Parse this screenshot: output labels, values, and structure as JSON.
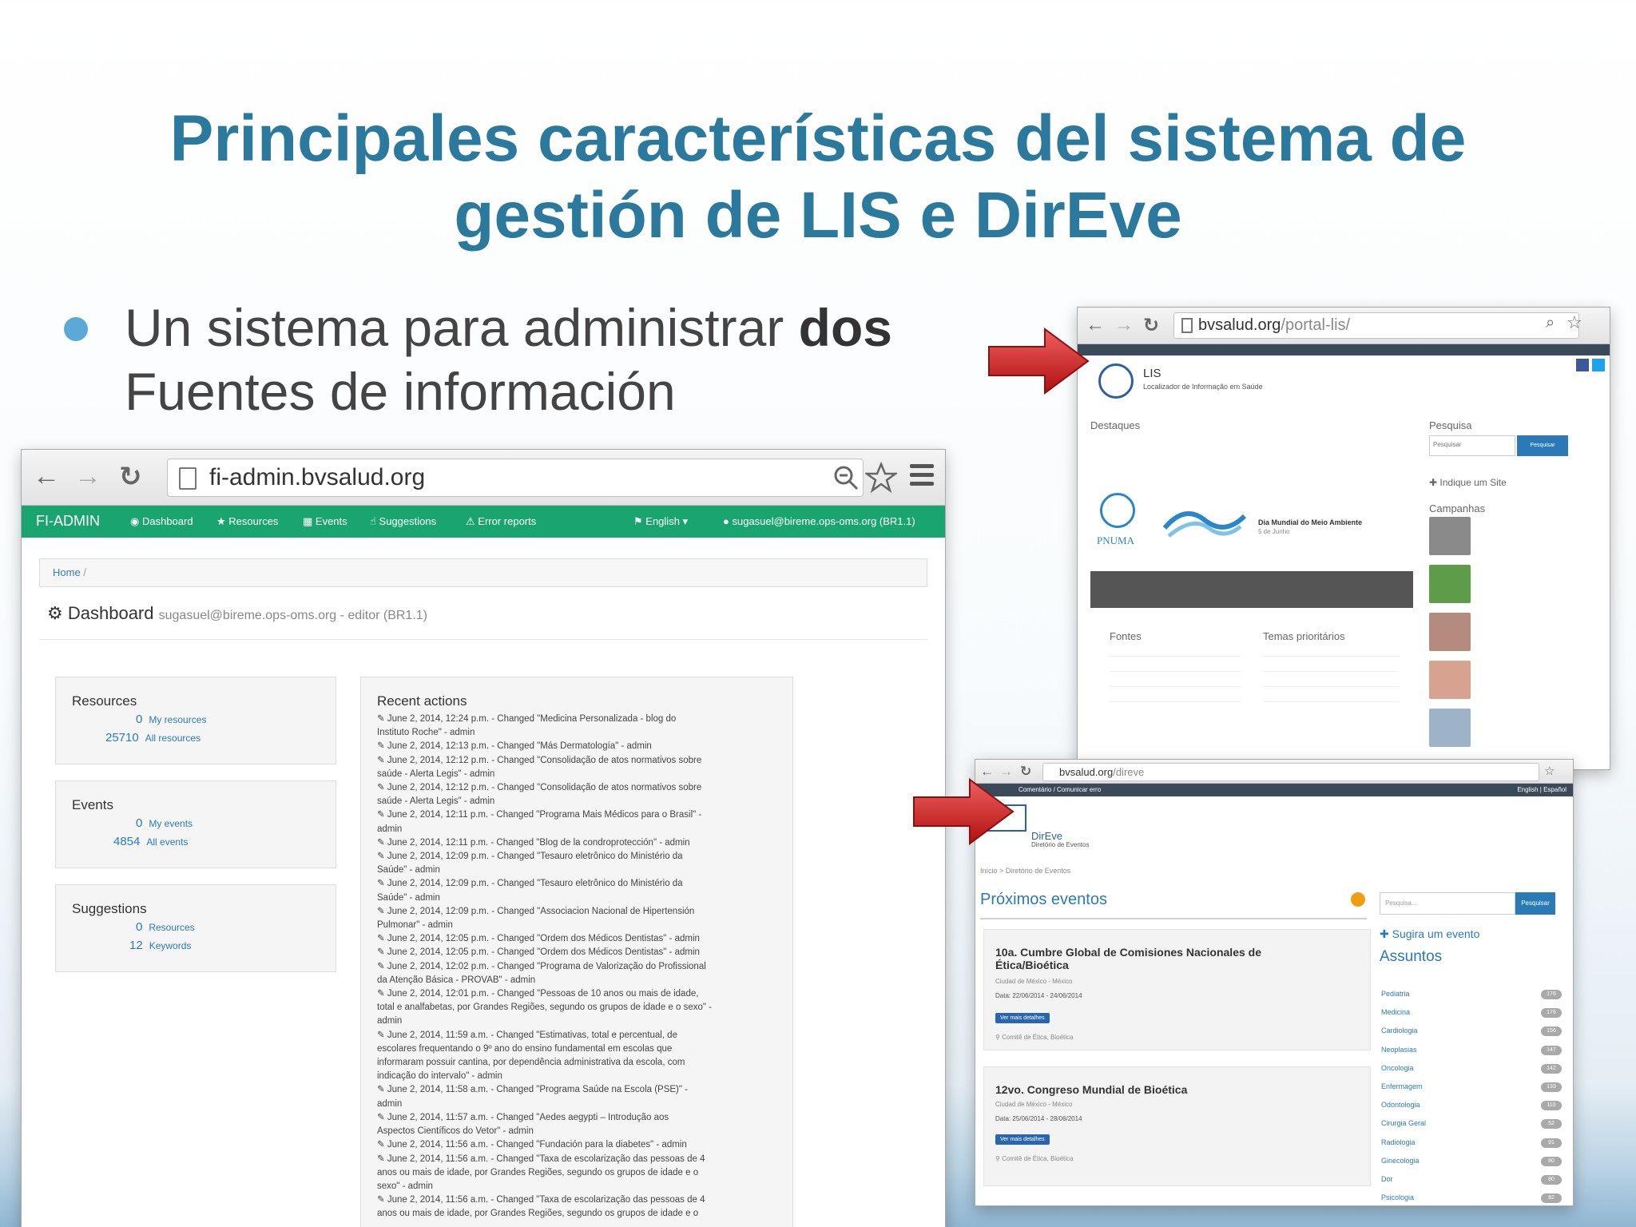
{
  "slide": {
    "title_line1": "Principales características del sistema de",
    "title_line2": "gestión de LIS e DirEve",
    "bullet_line1_pre": "Un sistema para administrar ",
    "bullet_line1_bold": "dos",
    "bullet_line2": "Fuentes de información"
  },
  "fi_admin": {
    "url": "fi-admin.bvsalud.org",
    "brand": "FI-ADMIN",
    "nav": [
      "Dashboard",
      "Resources",
      "Events",
      "Suggestions",
      "Error reports"
    ],
    "language": "English",
    "user": "sugasuel@bireme.ops-oms.org (BR1.1)",
    "breadcrumb": "Home",
    "dashboard_title": "Dashboard",
    "dashboard_sub": "sugasuel@bireme.ops-oms.org - editor (BR1.1)",
    "resources": {
      "title": "Resources",
      "my_count": "0",
      "my_label": "My resources",
      "all_count": "25710",
      "all_label": "All resources"
    },
    "events": {
      "title": "Events",
      "my_count": "0",
      "my_label": "My events",
      "all_count": "4854",
      "all_label": "All events"
    },
    "suggestions": {
      "title": "Suggestions",
      "res_count": "0",
      "res_label": "Resources",
      "kw_count": "12",
      "kw_label": "Keywords"
    },
    "recent_title": "Recent actions",
    "recent_lines": [
      "✎ June 2, 2014, 12:24 p.m. - Changed \"Medicina Personalizada - blog do",
      "Instituto Roche\" - admin",
      "✎ June 2, 2014, 12:13 p.m. - Changed \"Más Dermatología\" - admin",
      "✎ June 2, 2014, 12:12 p.m. - Changed \"Consolidação de atos normativos sobre",
      "saúde - Alerta Legis\" - admin",
      "✎ June 2, 2014, 12:12 p.m. - Changed \"Consolidação de atos normativos sobre",
      "saúde - Alerta Legis\" - admin",
      "✎ June 2, 2014, 12:11 p.m. - Changed \"Programa Mais Médicos para o Brasil\" -",
      "admin",
      "✎ June 2, 2014, 12:11 p.m. - Changed \"Blog de la condroprotección\" - admin",
      "✎ June 2, 2014, 12:09 p.m. - Changed \"Tesauro eletrônico do Ministério da",
      "Saúde\" - admin",
      "✎ June 2, 2014, 12:09 p.m. - Changed \"Tesauro eletrônico do Ministério da",
      "Saúde\" - admin",
      "✎ June 2, 2014, 12:09 p.m. - Changed \"Associacion Nacional de Hipertensión",
      "Pulmonar\" - admin",
      "✎ June 2, 2014, 12:05 p.m. - Changed \"Ordem dos Médicos Dentistas\" - admin",
      "✎ June 2, 2014, 12:05 p.m. - Changed \"Ordem dos Médicos Dentistas\" - admin",
      "✎ June 2, 2014, 12:02 p.m. - Changed \"Programa de Valorização do Profissional",
      "da Atenção Básica - PROVAB\" - admin",
      "✎ June 2, 2014, 12:01 p.m. - Changed \"Pessoas de 10 anos ou mais de idade,",
      "total e analfabetas, por Grandes Regiões, segundo os grupos de idade e o sexo\" -",
      "admin",
      "✎ June 2, 2014, 11:59 a.m. - Changed \"Estimativas, total e percentual, de",
      "escolares frequentando o 9º ano do ensino fundamental em escolas que",
      "informaram possuir cantina, por dependência administrativa da escola, com",
      "indicação do intervalo\" - admin",
      "✎ June 2, 2014, 11:58 a.m. - Changed \"Programa Saúde na Escola (PSE)\" -",
      "admin",
      "✎ June 2, 2014, 11:57 a.m. - Changed \"Aedes aegypti – Introdução aos",
      "Aspectos Científicos do Vetor\" - admin",
      "✎ June 2, 2014, 11:56 a.m. - Changed \"Fundación para la diabetes\" - admin",
      "✎ June 2, 2014, 11:56 a.m. - Changed \"Taxa de escolarização das pessoas de 4",
      "anos ou mais de idade, por Grandes Regiões, segundo os grupos de idade e o",
      "sexo\" - admin",
      "✎ June 2, 2014, 11:56 a.m. - Changed \"Taxa de escolarização das pessoas de 4",
      "anos ou mais de idade, por Grandes Regiões, segundo os grupos de idade e o"
    ]
  },
  "lis": {
    "url_domain": "bvsalud.org",
    "url_path": "/portal-lis/",
    "site_title": "LIS",
    "site_subtitle": "Localizador de Informação em Saúde",
    "destaques": "Destaques",
    "pesquisa": "Pesquisa",
    "search_placeholder": "Pesquisar",
    "search_button": "Pesquisar",
    "indique": "Indique um Site",
    "campanhas": "Campanhas",
    "pnuma": "PNUMA",
    "banner_title": "Dia Mundial do Meio Ambiente",
    "banner_date": "5 de Junho",
    "fontes": "Fontes",
    "temas": "Temas prioritários"
  },
  "direve": {
    "url_domain": "bvsalud.org",
    "url_path": "/direve",
    "top_bar": "Comentário / Comunicar erro",
    "top_right": "English | Español",
    "site_title": "DirEve",
    "site_subtitle": "Diretório de Eventos",
    "breadcrumb": "Início > Diretório de Eventos",
    "proximos": "Próximos eventos",
    "search_placeholder": "Pesquisa...",
    "search_button": "Pesquisar",
    "sugira": "Sugira um evento",
    "assuntos": "Assuntos",
    "event1_title": "10a. Cumbre Global de Comisiones Nacionales de Ética/Bioética",
    "event1_place": "Ciudad de México - México",
    "event1_date": "Data: 22/06/2014 - 24/06/2014",
    "event1_tag": "Comitê de Ética, Bioética",
    "event2_title": "12vo. Congreso Mundial de Bioética",
    "event2_place": "Ciudad de México - México",
    "event2_date": "Data: 25/06/2014 - 28/06/2014",
    "event2_tag": "Comitê de Ética, Bioética",
    "details_button": "Ver mais detalhes",
    "subjects": [
      "Pediatria",
      "Medicina",
      "Cardiologia",
      "Neoplasias",
      "Oncologia",
      "Enfermagem",
      "Odontologia",
      "Cirurgia Geral",
      "Radiologia",
      "Ginecologia",
      "Dor",
      "Psicologia"
    ],
    "subject_counts": [
      "176",
      "176",
      "156",
      "147",
      "142",
      "133",
      "110",
      "52",
      "91",
      "80",
      "80",
      "82"
    ]
  }
}
